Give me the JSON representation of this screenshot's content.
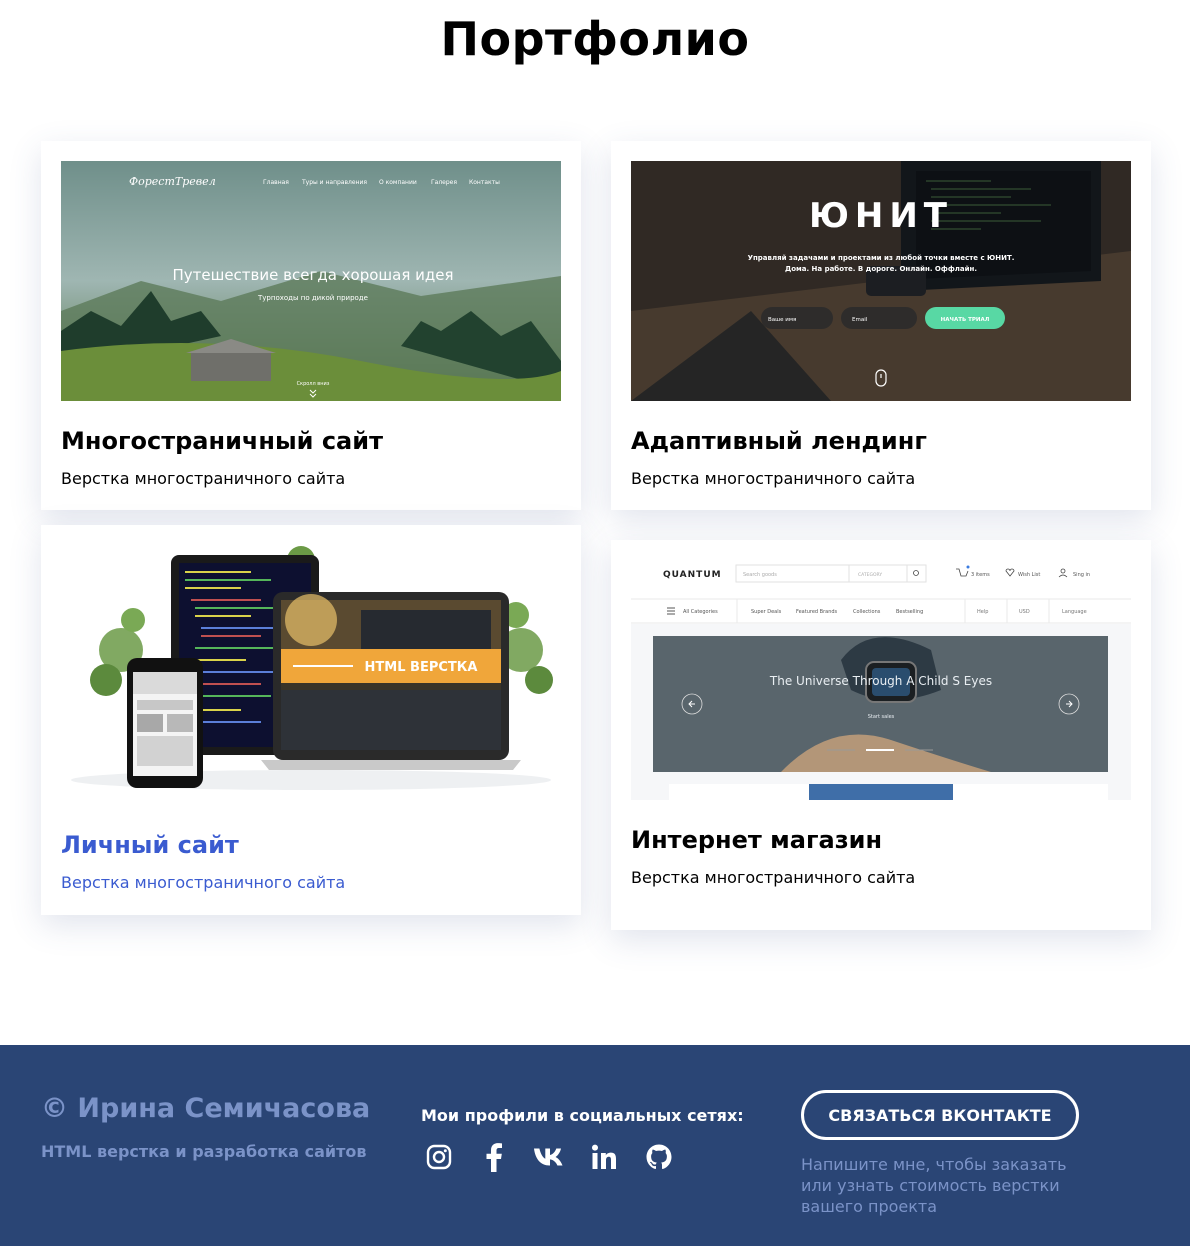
{
  "page": {
    "title": "Портфолио"
  },
  "cards": [
    {
      "title": "Многостраничный сайт",
      "description": "Верстка многостраничного сайта",
      "thumb": {
        "logo": "ФорестТревел",
        "nav": [
          "Главная",
          "Туры и направления",
          "О компании",
          "Галерея",
          "Контакты"
        ],
        "headline": "Путешествие всегда хорошая идея",
        "subline": "Турпоходы по дикой природе",
        "scroll": "Скролл вниз"
      }
    },
    {
      "title": "Адаптивный лендинг",
      "description": "Верстка многостраничного сайта",
      "thumb": {
        "brand": "ЮНИТ",
        "line1": "Управляй задачами и проектами из любой точки вместе с ЮНИТ.",
        "line2": "Дома. На работе. В дороге. Онлайн. Оффлайн.",
        "name_placeholder": "Ваше имя",
        "email_placeholder": "Email",
        "cta": "НАЧАТЬ ТРИАЛ"
      }
    },
    {
      "title": "Личный сайт",
      "description": "Верстка многостраничного сайта",
      "thumb": {
        "banner": "HTML ВЕРСТКА"
      }
    },
    {
      "title": "Интернет магазин",
      "description": "Верстка многостраничного сайта",
      "thumb": {
        "brand": "QUANTUM",
        "search_placeholder": "Search goods",
        "category": "CATEGORY",
        "cart": "3 items",
        "wishlist": "Wish List",
        "signin": "Sing in",
        "all_categories": "All Categories",
        "menu": [
          "Super Deals",
          "Featured Brands",
          "Collections",
          "Bestselling"
        ],
        "menu_right": [
          "Help",
          "USD",
          "Language"
        ],
        "slide_title": "The Universe Through A Child S Eyes",
        "slide_sub": "Start sales"
      }
    }
  ],
  "footer": {
    "name": "© Ирина Семичасова",
    "subtitle": "HTML верстка и разработка сайтов",
    "social_title": "Мои профили в социальных сетях:",
    "contact_button": "СВЯЗАТЬСЯ ВКОНТАКТЕ",
    "note": "Напишите мне, чтобы заказать или узнать стоимость верстки вашего проекта"
  },
  "colors": {
    "accent": "#3a5bd0",
    "footer_bg": "#2a4575",
    "footer_muted": "#7b93c8"
  },
  "icons": [
    "instagram-icon",
    "facebook-icon",
    "vk-icon",
    "linkedin-icon",
    "github-icon"
  ]
}
